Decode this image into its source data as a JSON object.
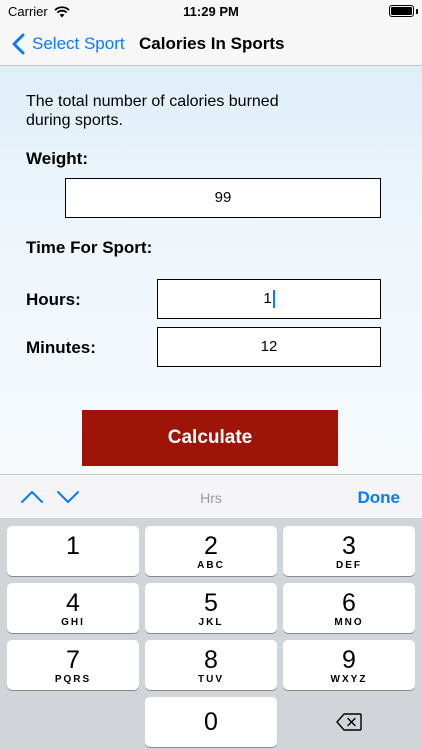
{
  "status_bar": {
    "carrier": "Carrier",
    "time": "11:29 PM"
  },
  "nav": {
    "back_label": "Select Sport",
    "title": "Calories In Sports"
  },
  "form": {
    "intro": "The total number of calories burned during sports.",
    "weight_label": "Weight:",
    "weight_value": "99",
    "time_label": "Time For Sport:",
    "hours_label": "Hours:",
    "hours_value": "1",
    "minutes_label": "Minutes:",
    "minutes_value": "12",
    "calculate_label": "Calculate"
  },
  "keyboard_toolbar": {
    "hint": "Hrs",
    "done_label": "Done"
  },
  "keypad": {
    "keys": [
      {
        "digit": "1",
        "letters": ""
      },
      {
        "digit": "2",
        "letters": "ABC"
      },
      {
        "digit": "3",
        "letters": "DEF"
      },
      {
        "digit": "4",
        "letters": "GHI"
      },
      {
        "digit": "5",
        "letters": "JKL"
      },
      {
        "digit": "6",
        "letters": "MNO"
      },
      {
        "digit": "7",
        "letters": "PQRS"
      },
      {
        "digit": "8",
        "letters": "TUV"
      },
      {
        "digit": "9",
        "letters": "WXYZ"
      },
      {
        "digit": "0",
        "letters": ""
      }
    ]
  },
  "colors": {
    "accent": "#0a7aff",
    "calculate_button": "#9e1508"
  }
}
